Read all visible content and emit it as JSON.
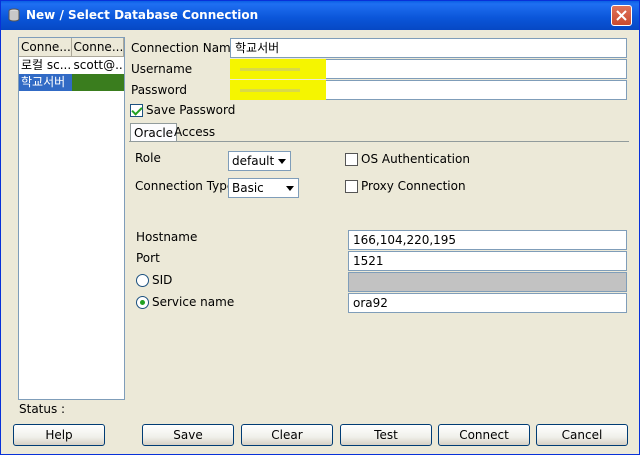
{
  "window": {
    "title": "New / Select Database Connection"
  },
  "connections_list": {
    "columns": [
      "Conne...",
      "Conne..."
    ],
    "rows": [
      {
        "name": "로컬 sc...",
        "conn": "scott@...",
        "selected": false
      },
      {
        "name": "학교서버",
        "conn": "",
        "selected": true
      }
    ]
  },
  "status": {
    "label": "Status :"
  },
  "form": {
    "connection_name": {
      "label": "Connection Name",
      "value": "학교서버"
    },
    "username": {
      "label": "Username"
    },
    "password": {
      "label": "Password"
    },
    "save_password": {
      "label": "Save Password",
      "checked": true
    }
  },
  "tabs": [
    {
      "label": "Oracle",
      "active": true
    },
    {
      "label": "Access",
      "active": false
    }
  ],
  "oracle": {
    "role": {
      "label": "Role",
      "value": "default"
    },
    "connection_type": {
      "label": "Connection Type",
      "value": "Basic"
    },
    "os_auth": {
      "label": "OS Authentication",
      "checked": false
    },
    "proxy": {
      "label": "Proxy Connection",
      "checked": false
    },
    "hostname": {
      "label": "Hostname",
      "value": "166,104,220,195"
    },
    "port": {
      "label": "Port",
      "value": "1521"
    },
    "sid": {
      "label": "SID",
      "value": "",
      "selected": false
    },
    "service_name": {
      "label": "Service name",
      "value": "ora92",
      "selected": true
    }
  },
  "buttons": {
    "help": "Help",
    "save": "Save",
    "clear": "Clear",
    "test": "Test",
    "connect": "Connect",
    "cancel": "Cancel"
  },
  "colors": {
    "titlebar": "#0a55d8",
    "highlight": "#f5f500",
    "selection": "#316ac5"
  }
}
